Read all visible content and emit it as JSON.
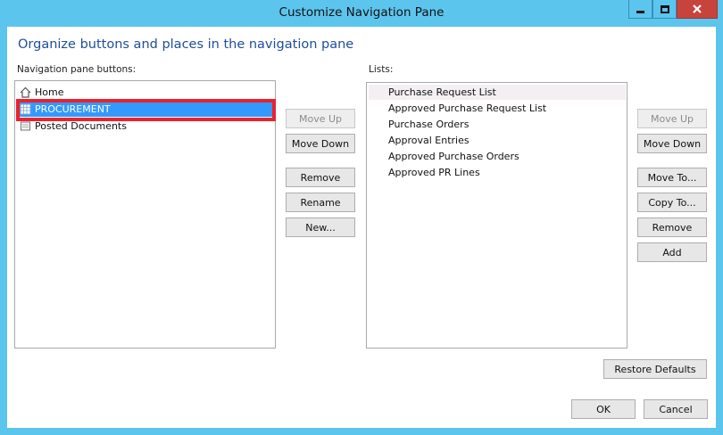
{
  "window": {
    "title": "Customize Navigation Pane"
  },
  "heading": "Organize buttons and places in the navigation pane",
  "nav_pane": {
    "label": "Navigation pane buttons:",
    "items": [
      {
        "label": "Home",
        "icon": "home-icon"
      },
      {
        "label": "PROCUREMENT",
        "icon": "grid-icon",
        "selected": true
      },
      {
        "label": "Posted Documents",
        "icon": "document-icon"
      }
    ],
    "buttons": {
      "move_up": "Move Up",
      "move_down": "Move Down",
      "remove": "Remove",
      "rename": "Rename",
      "new": "New..."
    }
  },
  "lists": {
    "label": "Lists:",
    "items": [
      "Purchase Request List",
      "Approved Purchase Request List",
      "Purchase Orders",
      "Approval Entries",
      "Approved Purchase Orders",
      "Approved PR Lines"
    ],
    "buttons": {
      "move_up": "Move Up",
      "move_down": "Move Down",
      "move_to": "Move To...",
      "copy_to": "Copy To...",
      "remove": "Remove",
      "add": "Add"
    }
  },
  "footer": {
    "restore_defaults": "Restore Defaults",
    "ok": "OK",
    "cancel": "Cancel"
  },
  "colors": {
    "title_bar": "#5cc5ee",
    "selection": "#3399ff",
    "highlight_outline": "#e8232f",
    "heading": "#1e4e9c",
    "close_button": "#c7443d"
  }
}
